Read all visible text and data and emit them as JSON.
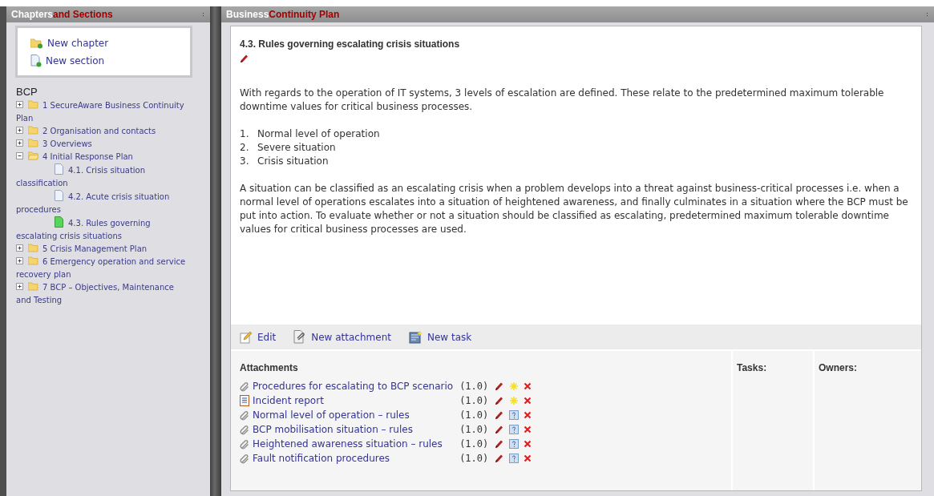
{
  "left_panel": {
    "title": "Chapters",
    "title_accent": "and Sections",
    "actions": [
      {
        "kind": "chapter",
        "label": "New chapter"
      },
      {
        "kind": "section",
        "label": "New section"
      }
    ],
    "tree_title": "BCP",
    "tree": [
      {
        "label": "1 SecureAware Business Continuity Plan",
        "expanded": false
      },
      {
        "label": "2 Organisation and contacts",
        "expanded": false
      },
      {
        "label": "3 Overviews",
        "expanded": false
      },
      {
        "label": "4 Initial Response Plan",
        "expanded": true,
        "children": [
          {
            "label": "4.1. Crisis situation classification",
            "selected": false
          },
          {
            "label": "4.2. Acute crisis situation procedures",
            "selected": false
          },
          {
            "label": "4.3. Rules governing escalating crisis situations",
            "selected": true
          }
        ]
      },
      {
        "label": "5 Crisis Management Plan",
        "expanded": false
      },
      {
        "label": "6 Emergency operation and service recovery plan",
        "expanded": false
      },
      {
        "label": "7 BCP – Objectives, Maintenance and Testing",
        "expanded": false
      }
    ]
  },
  "right_panel": {
    "title": "Business",
    "title_accent": "Continuity Plan",
    "section_title": "4.3. Rules governing escalating crisis situations",
    "intro": "With regards to the operation of IT systems, 3 levels of escalation are defined. These relate to the predetermined maximum tolerable downtime values for critical business processes.",
    "levels": [
      {
        "number": "1.",
        "text": "Normal level of operation"
      },
      {
        "number": "2.",
        "text": "Severe situation"
      },
      {
        "number": "3.",
        "text": "Crisis situation"
      }
    ],
    "body": "A situation can be classified as an escalating crisis when a problem develops into a threat against business-critical processes i.e. when a normal level of operations escalates into a situation of heightened awareness, and finally culminates in a situation where the BCP must be put into action. To evaluate whether or not a situation should be classified as escalating, predetermined maximum tolerable downtime values for critical business processes are used.",
    "toolbar": [
      {
        "kind": "edit",
        "label": "Edit"
      },
      {
        "kind": "attachment",
        "label": "New attachment"
      },
      {
        "kind": "task",
        "label": "New task"
      }
    ],
    "attachments_heading": "Attachments",
    "tasks_heading": "Tasks:",
    "owners_heading": "Owners:",
    "attachments": [
      {
        "kind": "file",
        "name": "Procedures for escalating to BCP scenario",
        "version": "(1.0)",
        "is_new": true
      },
      {
        "kind": "report",
        "name": "Incident report",
        "version": "(1.0)",
        "is_new": true
      },
      {
        "kind": "file",
        "name": "Normal level of operation – rules",
        "version": "(1.0)",
        "is_new": false
      },
      {
        "kind": "file",
        "name": "BCP mobilisation situation – rules",
        "version": "(1.0)",
        "is_new": false
      },
      {
        "kind": "file",
        "name": "Heightened awareness situation – rules",
        "version": "(1.0)",
        "is_new": false
      },
      {
        "kind": "file",
        "name": "Fault notification procedures",
        "version": "(1.0)",
        "is_new": false
      }
    ]
  }
}
